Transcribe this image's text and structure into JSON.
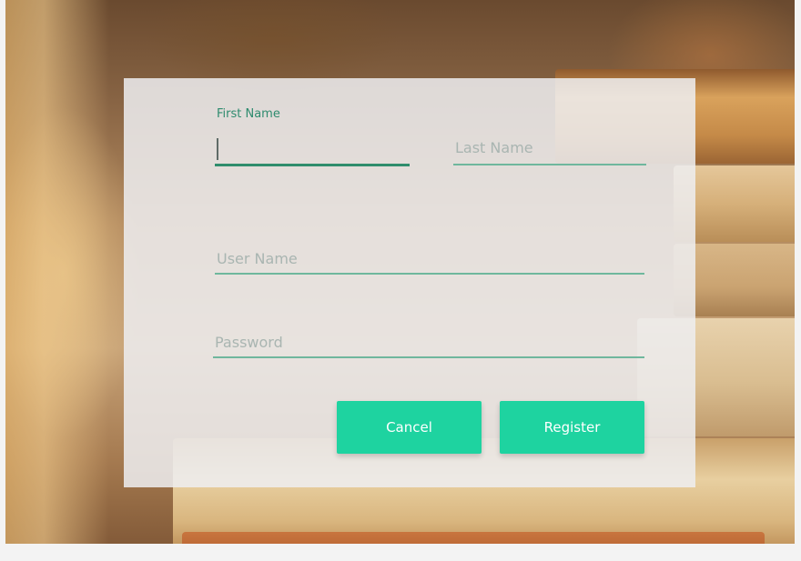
{
  "form": {
    "first_name": {
      "label": "First Name",
      "value": ""
    },
    "last_name": {
      "placeholder": "Last Name",
      "value": ""
    },
    "user_name": {
      "placeholder": "User Name",
      "value": ""
    },
    "password": {
      "placeholder": "Password",
      "value": ""
    }
  },
  "buttons": {
    "cancel_label": "Cancel",
    "register_label": "Register"
  },
  "colors": {
    "accent": "#1ed3a0",
    "underline": "#6fb79d",
    "label": "#2e8b6e"
  }
}
